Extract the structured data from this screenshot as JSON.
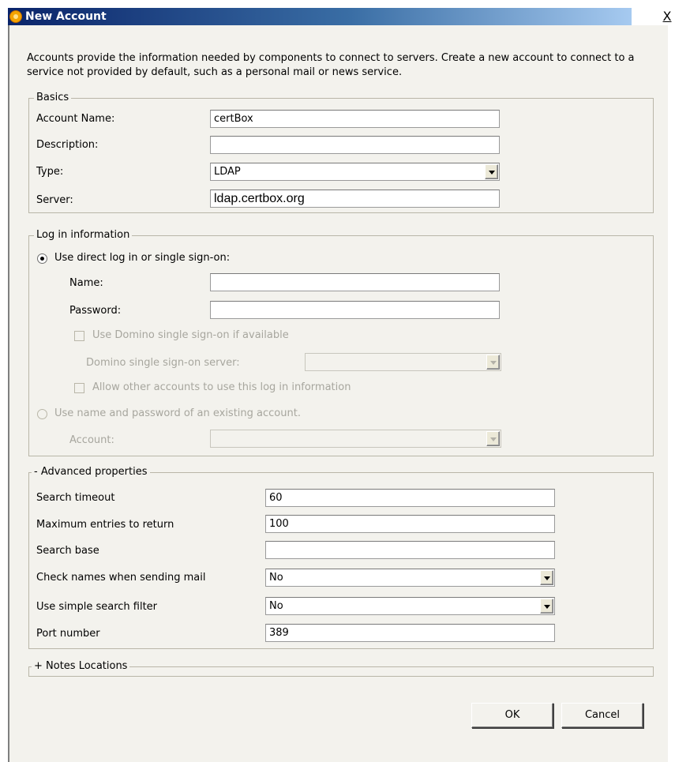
{
  "window": {
    "title": "New Account",
    "close_label": "X"
  },
  "intro": "Accounts provide the information needed by components to connect to servers. Create a new account to connect to a service not provided by default, such as a personal mail or news service.",
  "basics": {
    "legend": "Basics",
    "account_name_label": "Account Name:",
    "account_name_value": "certBox",
    "description_label": "Description:",
    "description_value": "",
    "type_label": "Type:",
    "type_value": "LDAP",
    "server_label": "Server:",
    "server_value": "ldap.certbox.org"
  },
  "login": {
    "legend": "Log in information",
    "direct_radio": "Use direct log in or single sign-on:",
    "name_label": "Name:",
    "name_value": "",
    "password_label": "Password:",
    "password_value": "",
    "domino_sso_checkbox": "Use Domino single sign-on if available",
    "domino_server_label": "Domino single sign-on server:",
    "domino_server_value": "",
    "allow_others_checkbox": "Allow other accounts to use this log in information",
    "existing_radio": "Use name and password of an existing account.",
    "account_label": "Account:",
    "account_value": ""
  },
  "advanced": {
    "legend": "- Advanced properties",
    "search_timeout_label": "Search timeout",
    "search_timeout_value": "60",
    "max_entries_label": "Maximum entries to return",
    "max_entries_value": "100",
    "search_base_label": "Search base",
    "search_base_value": "",
    "check_names_label": "Check names when sending mail",
    "check_names_value": "No",
    "simple_filter_label": "Use simple search filter",
    "simple_filter_value": "No",
    "port_label": "Port number",
    "port_value": "389"
  },
  "notes": {
    "legend": "+ Notes Locations"
  },
  "buttons": {
    "ok": "OK",
    "cancel": "Cancel"
  },
  "icons": {
    "app": "lotus-notes-icon"
  },
  "colors": {
    "titlebar_start": "#0a246a",
    "titlebar_end": "#a6caf0",
    "dialog_bg": "#f3f2ed"
  }
}
